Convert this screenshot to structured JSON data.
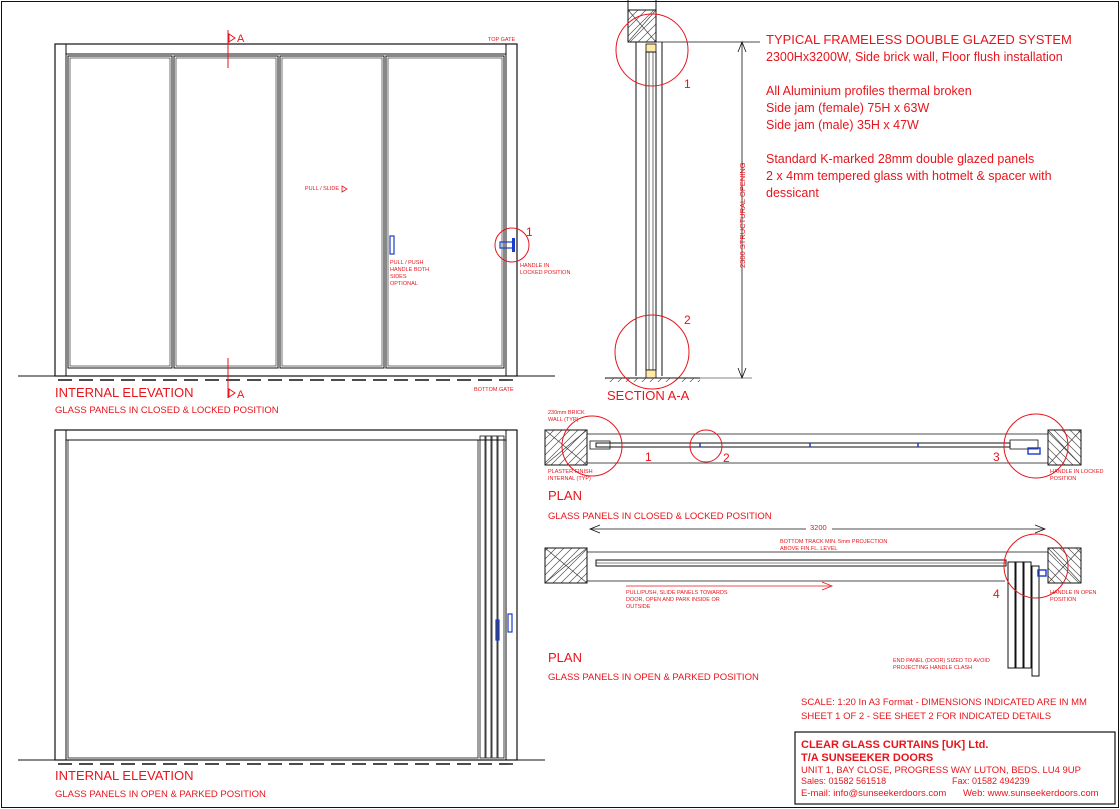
{
  "colors": {
    "red": "#e8141c",
    "black": "#111111",
    "blue": "#1a3cc8",
    "hatch": "#555555"
  },
  "spec": {
    "title": "TYPICAL FRAMELESS DOUBLE GLAZED SYSTEM",
    "subtitle": "2300Hx3200W, Side brick wall, Floor flush installation",
    "line1": "All Aluminium profiles thermal broken",
    "line2": "Side jam (female) 75H x 63W",
    "line3": "Side jam (male) 35H x 47W",
    "line4": "Standard K-marked 28mm double glazed panels",
    "line5": "2 x 4mm tempered glass with hotmelt & spacer with",
    "line6": "dessicant"
  },
  "elevation_closed": {
    "title": "INTERNAL ELEVATION",
    "subtitle": "GLASS PANELS IN CLOSED & LOCKED POSITION",
    "top_gate": "TOP GATE",
    "bottom_gate": "BOTTOM GATE",
    "section_marker": "A",
    "pull_slide": "PULL / SLIDE",
    "pull_push_1": "PULL / PUSH",
    "pull_push_2": "HANDLE BOTH",
    "pull_push_3": "SIDES",
    "pull_push_4": "OPTIONAL",
    "handle_1": "HANDLE IN",
    "handle_2": "LOCKED POSITION",
    "detail_1": "1"
  },
  "section": {
    "title": "SECTION A-A",
    "dimension": "2300 STRUCTURAL OPENING",
    "detail_1": "1",
    "detail_2": "2"
  },
  "plan_closed": {
    "title": "PLAN",
    "subtitle": "GLASS PANELS IN CLOSED & LOCKED POSITION",
    "brick_1": "230mm BRICK",
    "brick_2": "WALL (TYP)",
    "plaster_1": "PLASTER FINISH",
    "plaster_2": "INTERNAL (TYP)",
    "handle_1": "HANDLE IN LOCKED",
    "handle_2": "POSITION",
    "detail_1": "1",
    "detail_2": "2",
    "detail_3": "3"
  },
  "plan_open": {
    "title": "PLAN",
    "subtitle": "GLASS PANELS IN OPEN & PARKED POSITION",
    "dimension": "3200",
    "track_1": "BOTTOM TRACK MIN. 5mm PROJECTION",
    "track_2": "ABOVE FIN.FL. LEVEL",
    "pull_1": "PULL/PUSH, SLIDE PANELS TOWARDS",
    "pull_2": "DOOR, OPEN AND PARK INSIDE OR",
    "pull_3": "OUTSIDE",
    "handle_1": "HANDLE IN OPEN",
    "handle_2": "POSITION",
    "end_1": "END PANEL (DOOR) SIZED TO AVOID",
    "end_2": "PROJECTING HANDLE CLASH",
    "detail_4": "4"
  },
  "elevation_open": {
    "title": "INTERNAL ELEVATION",
    "subtitle": "GLASS PANELS IN OPEN & PARKED POSITION"
  },
  "notes": {
    "scale": "SCALE: 1:20 In A3 Format  - DIMENSIONS INDICATED ARE IN MM",
    "sheet": "SHEET 1 OF 2 - SEE SHEET 2 FOR INDICATED DETAILS"
  },
  "titleblock": {
    "company": "CLEAR GLASS CURTAINS [UK] Ltd.",
    "trading": "T/A SUNSEEKER DOORS",
    "address": "UNIT 1, BAY CLOSE, PROGRESS WAY LUTON, BEDS. LU4 9UP",
    "sales": "Sales: 01582 561518",
    "fax": "Fax: 01582 494239",
    "email": "E-mail: info@sunseekerdoors.com",
    "web": "Web: www.sunseekerdoors.com"
  }
}
